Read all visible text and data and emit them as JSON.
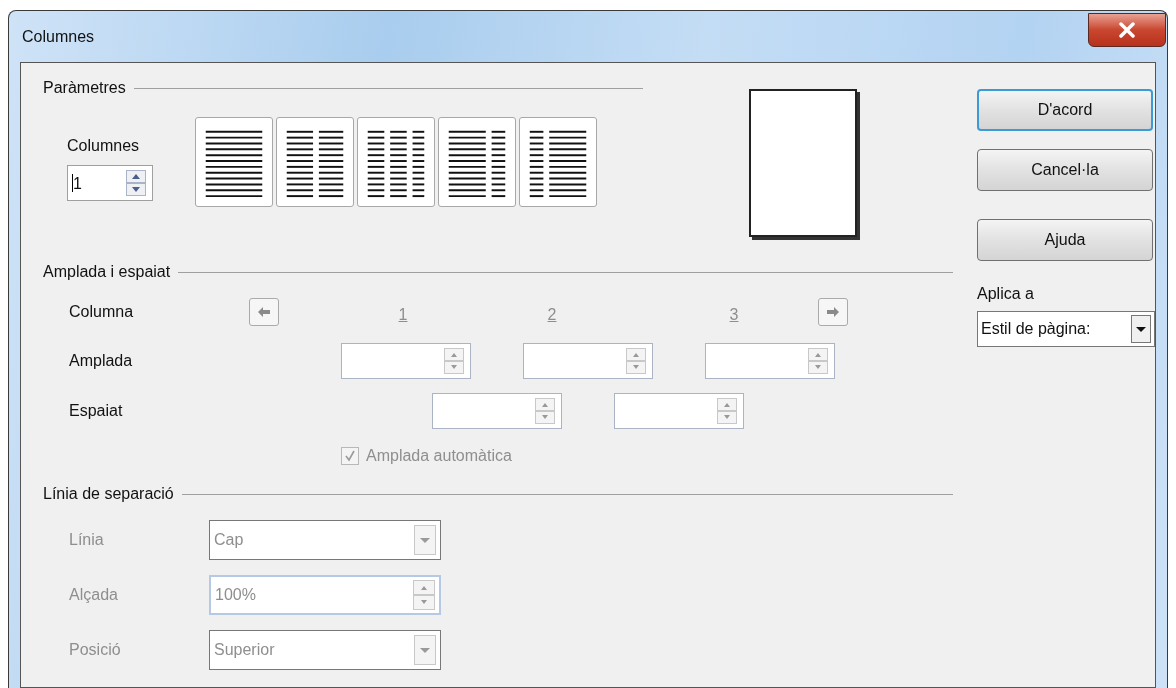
{
  "window": {
    "title": "Columnes"
  },
  "parameters": {
    "title": "Paràmetres",
    "columns_label": "Columnes",
    "columns_value": "1",
    "presets": [
      {
        "kind": "one"
      },
      {
        "kind": "two"
      },
      {
        "kind": "three"
      },
      {
        "kind": "left"
      },
      {
        "kind": "right"
      }
    ]
  },
  "width_spacing": {
    "title": "Amplada i espaiat",
    "column_label": "Columna",
    "columns": [
      "1",
      "2",
      "3"
    ],
    "width_label": "Amplada",
    "spacing_label": "Espaiat",
    "disabled": true,
    "auto_width": {
      "label": "Amplada automàtica",
      "checked": true,
      "disabled": true
    }
  },
  "separator": {
    "title": "Línia de separació",
    "fields": [
      {
        "label": "Línia",
        "kind": "dropdown",
        "value": "Cap",
        "disabled": true
      },
      {
        "label": "Alçada",
        "kind": "spin",
        "value": "100%",
        "disabled": true
      },
      {
        "label": "Posició",
        "kind": "dropdown",
        "value": "Superior",
        "disabled": true
      }
    ]
  },
  "buttons": [
    {
      "label": "D'acord",
      "default": true
    },
    {
      "label": "Cancel·la",
      "default": false
    },
    {
      "label": "Ajuda",
      "default": false
    }
  ],
  "apply_to": {
    "label": "Aplica a",
    "value": "Estil de pàgina:"
  }
}
